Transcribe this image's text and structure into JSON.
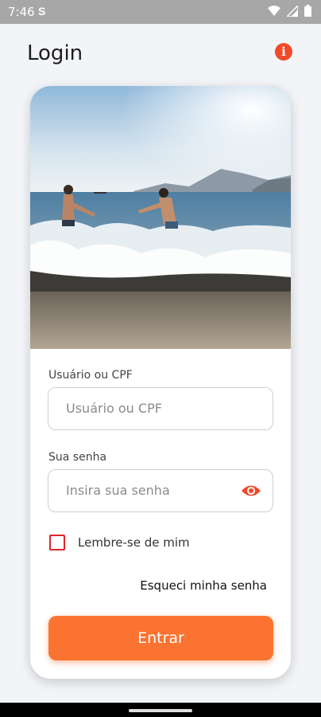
{
  "status": {
    "time": "7:46",
    "notification_icon": "S",
    "icons": [
      "wifi-icon",
      "signal-icon",
      "battery-icon"
    ]
  },
  "header": {
    "title": "Login",
    "info_icon": "i"
  },
  "hero": {
    "image": "beach-couple-photo"
  },
  "form": {
    "user_label": "Usuário ou CPF",
    "user_placeholder": "Usuário ou CPF",
    "password_label": "Sua senha",
    "password_placeholder": "Insira sua senha",
    "remember_label": "Lembre-se de mim",
    "forgot_label": "Esqueci minha senha",
    "submit_label": "Entrar"
  },
  "colors": {
    "accent": "#fa7330",
    "info": "#f04a28",
    "checkbox": "#e0252a"
  }
}
